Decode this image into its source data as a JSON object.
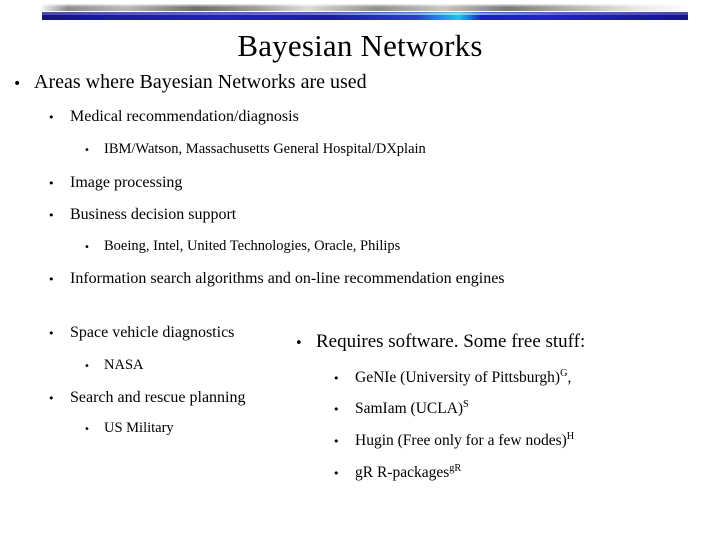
{
  "slide": {
    "title": "Bayesian Networks",
    "banner": {
      "gray_gradient": "#f2f2f2 to #6f6f6f metallic",
      "blue_color": "#2222bd",
      "highlight_color": "#19c6e8"
    },
    "bullet_glyph": "•",
    "left_column": {
      "heading": "Areas where Bayesian Networks are used",
      "items": [
        {
          "level": 2,
          "text": "Medical recommendation/diagnosis",
          "children": [
            {
              "level": 3,
              "text": "IBM/Watson, Massachusetts General Hospital/DXplain"
            }
          ]
        },
        {
          "level": 2,
          "text": "Image processing",
          "children": []
        },
        {
          "level": 2,
          "text": "Business decision support",
          "children": [
            {
              "level": 3,
              "text": "Boeing, Intel, United Technologies, Oracle, Philips"
            }
          ]
        },
        {
          "level": 2,
          "text": "Information search algorithms and on-line recommendation engines",
          "children": []
        },
        {
          "level": 2,
          "text": "Space vehicle diagnostics",
          "children": [
            {
              "level": 3,
              "text": "NASA"
            }
          ]
        },
        {
          "level": 2,
          "text": "Search and rescue planning",
          "children": [
            {
              "level": 3,
              "text": "US Military"
            }
          ]
        }
      ]
    },
    "right_column": {
      "heading": "Requires software. Some free stuff:",
      "items": [
        {
          "text": "GeNIe (University of Pittsburgh)",
          "superscript": "G",
          "suffix": ","
        },
        {
          "text": "SamIam (UCLA)",
          "superscript": "S",
          "suffix": ""
        },
        {
          "text": "Hugin (Free only for a few nodes)",
          "superscript": "H",
          "suffix": ""
        },
        {
          "text": "gR R-packages",
          "superscript": "gR",
          "suffix": ""
        }
      ]
    }
  }
}
